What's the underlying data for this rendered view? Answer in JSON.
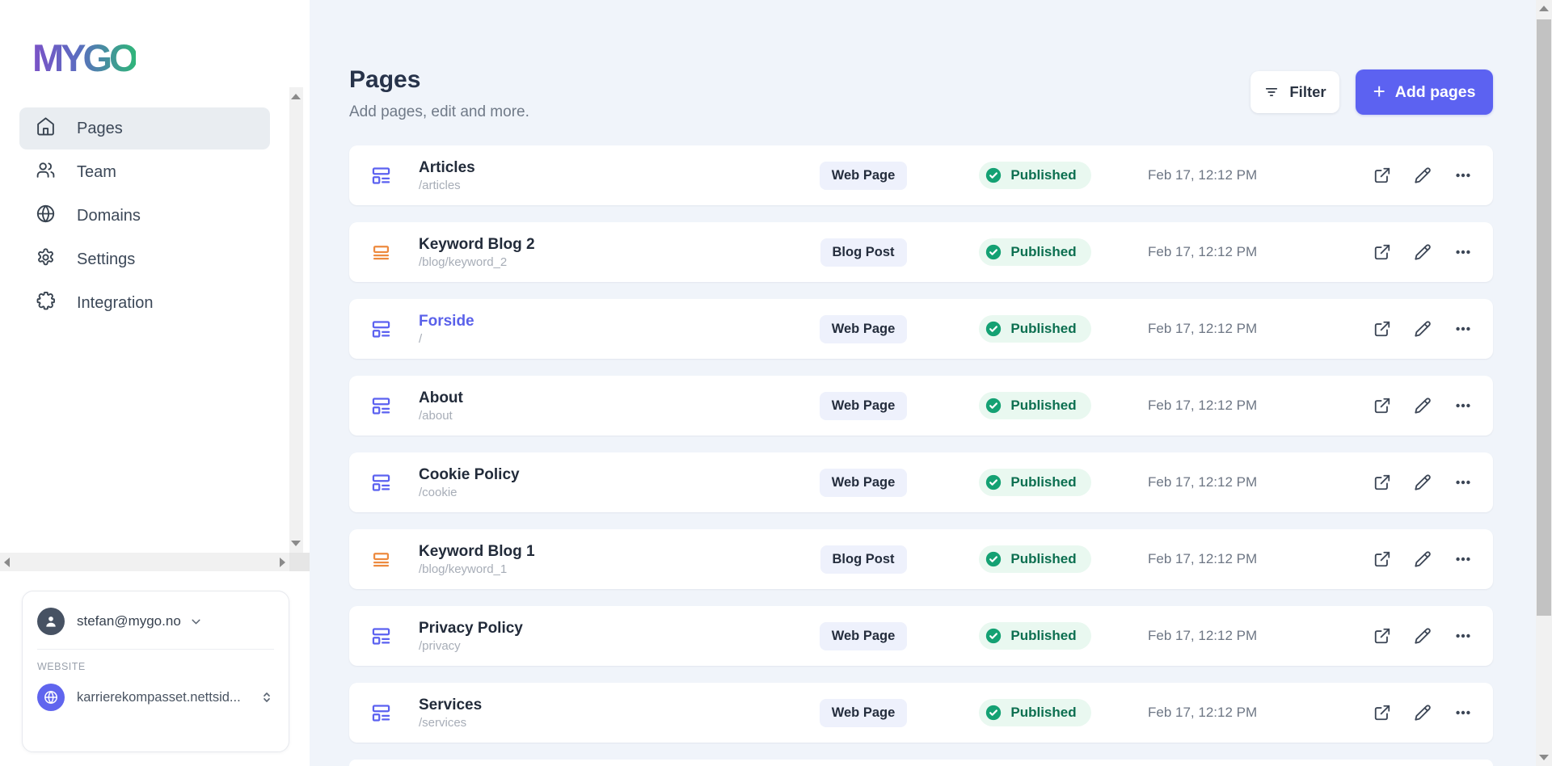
{
  "brand": {
    "logo": "MYGO"
  },
  "sidebar": {
    "items": [
      {
        "label": "Pages",
        "icon": "home-icon",
        "active": true
      },
      {
        "label": "Team",
        "icon": "users-icon",
        "active": false
      },
      {
        "label": "Domains",
        "icon": "globe-icon",
        "active": false
      },
      {
        "label": "Settings",
        "icon": "gear-icon",
        "active": false
      },
      {
        "label": "Integration",
        "icon": "puzzle-icon",
        "active": false
      }
    ]
  },
  "account": {
    "email": "stefan@mygo.no",
    "website_label": "WEBSITE",
    "website_value": "karrierekompasset.nettsid..."
  },
  "header": {
    "title": "Pages",
    "subtitle": "Add pages, edit and more.",
    "filter_label": "Filter",
    "add_label": "Add pages",
    "add_plus": "+"
  },
  "pages": [
    {
      "title": "Articles",
      "slug": "/articles",
      "type": "Web Page",
      "icon": "web-page",
      "status": "Published",
      "date": "Feb 17, 12:12 PM",
      "highlighted": false
    },
    {
      "title": "Keyword Blog 2",
      "slug": "/blog/keyword_2",
      "type": "Blog Post",
      "icon": "blog-post",
      "status": "Published",
      "date": "Feb 17, 12:12 PM",
      "highlighted": false
    },
    {
      "title": "Forside",
      "slug": "/",
      "type": "Web Page",
      "icon": "web-page",
      "status": "Published",
      "date": "Feb 17, 12:12 PM",
      "highlighted": true
    },
    {
      "title": "About",
      "slug": "/about",
      "type": "Web Page",
      "icon": "web-page",
      "status": "Published",
      "date": "Feb 17, 12:12 PM",
      "highlighted": false
    },
    {
      "title": "Cookie Policy",
      "slug": "/cookie",
      "type": "Web Page",
      "icon": "web-page",
      "status": "Published",
      "date": "Feb 17, 12:12 PM",
      "highlighted": false
    },
    {
      "title": "Keyword Blog 1",
      "slug": "/blog/keyword_1",
      "type": "Blog Post",
      "icon": "blog-post",
      "status": "Published",
      "date": "Feb 17, 12:12 PM",
      "highlighted": false
    },
    {
      "title": "Privacy Policy",
      "slug": "/privacy",
      "type": "Web Page",
      "icon": "web-page",
      "status": "Published",
      "date": "Feb 17, 12:12 PM",
      "highlighted": false
    },
    {
      "title": "Services",
      "slug": "/services",
      "type": "Web Page",
      "icon": "web-page",
      "status": "Published",
      "date": "Feb 17, 12:12 PM",
      "highlighted": false
    }
  ],
  "colors": {
    "accent": "#5c62f1",
    "webpage_icon": "#5b61f0",
    "blogpost_icon": "#ed8a3f",
    "published_dot": "#14a173",
    "published_text": "#0c6f50",
    "published_bg": "#e9f8f0",
    "type_badge_bg": "#eef1fc",
    "highlighted_title": "#5a61ea"
  }
}
